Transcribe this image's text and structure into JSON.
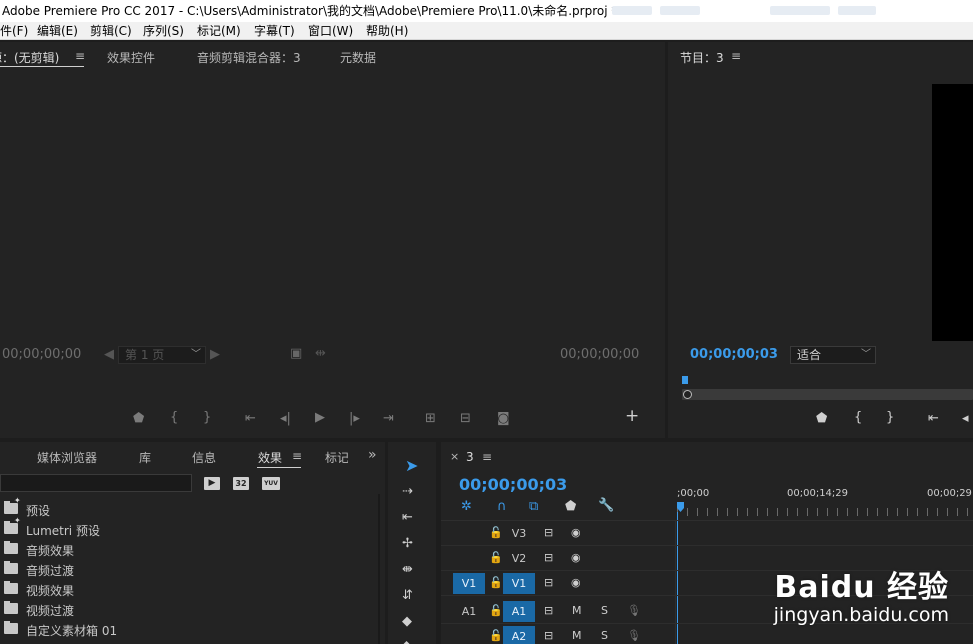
{
  "window": {
    "title": "Adobe Premiere Pro CC 2017 - C:\\Users\\Administrator\\我的文档\\Adobe\\Premiere Pro\\11.0\\未命名.prproj *"
  },
  "menubar": [
    "件(F)",
    "编辑(E)",
    "剪辑(C)",
    "序列(S)",
    "标记(M)",
    "字幕(T)",
    "窗口(W)",
    "帮助(H)"
  ],
  "source_panel": {
    "tabs": [
      {
        "label": "源：(无剪辑)",
        "active": true
      },
      {
        "label": "效果控件",
        "active": false
      },
      {
        "label": "音频剪辑混合器：3",
        "active": false
      },
      {
        "label": "元数据",
        "active": false
      }
    ],
    "timecode_left": "00;00;00;00",
    "timecode_right": "00;00;00;00",
    "page_select": "第 1 页"
  },
  "program_panel": {
    "tab": "节目：3",
    "timecode": "00;00;00;03",
    "fit_select": "适合"
  },
  "effects_panel": {
    "tabs": [
      {
        "label": "媒体浏览器",
        "active": false
      },
      {
        "label": "库",
        "active": false
      },
      {
        "label": "信息",
        "active": false
      },
      {
        "label": "效果",
        "active": true
      },
      {
        "label": "标记",
        "active": false
      }
    ],
    "overflow": "»",
    "search": {
      "value": "",
      "placeholder": ""
    },
    "toolbar_badges": [
      "32",
      "YUV"
    ],
    "items": [
      {
        "label": "预设",
        "icon": "preset-folder-icon",
        "starred": true
      },
      {
        "label": "Lumetri 预设",
        "icon": "preset-folder-icon",
        "starred": true
      },
      {
        "label": "音频效果",
        "icon": "folder-icon",
        "starred": false
      },
      {
        "label": "音频过渡",
        "icon": "folder-icon",
        "starred": false
      },
      {
        "label": "视频效果",
        "icon": "folder-icon",
        "starred": false
      },
      {
        "label": "视频过渡",
        "icon": "folder-icon",
        "starred": false
      },
      {
        "label": "自定义素材箱 01",
        "icon": "folder-icon",
        "starred": false
      }
    ]
  },
  "timeline": {
    "tab_close": "×",
    "tab": "3",
    "timecode": "00;00;00;03",
    "ruler": [
      ";00;00",
      "00;00;14;29",
      "00;00;29"
    ],
    "tracks": [
      {
        "source": "",
        "name": "V3",
        "target": false,
        "kind": "video",
        "m": "",
        "s": ""
      },
      {
        "source": "",
        "name": "V2",
        "target": false,
        "kind": "video",
        "m": "",
        "s": ""
      },
      {
        "source": "V1",
        "name": "V1",
        "target": true,
        "kind": "video",
        "m": "",
        "s": ""
      },
      {
        "source": "A1",
        "name": "A1",
        "target": true,
        "kind": "audio",
        "m": "M",
        "s": "S"
      },
      {
        "source": "",
        "name": "A2",
        "target": true,
        "kind": "audio",
        "m": "M",
        "s": "S"
      }
    ]
  },
  "watermark": {
    "brand": "Baidu 经验",
    "url": "jingyan.baidu.com"
  },
  "colors": {
    "accent": "#3b9bea",
    "track_target": "#1a69a6",
    "panel_bg": "#232323",
    "app_bg": "#1d1d1d"
  }
}
